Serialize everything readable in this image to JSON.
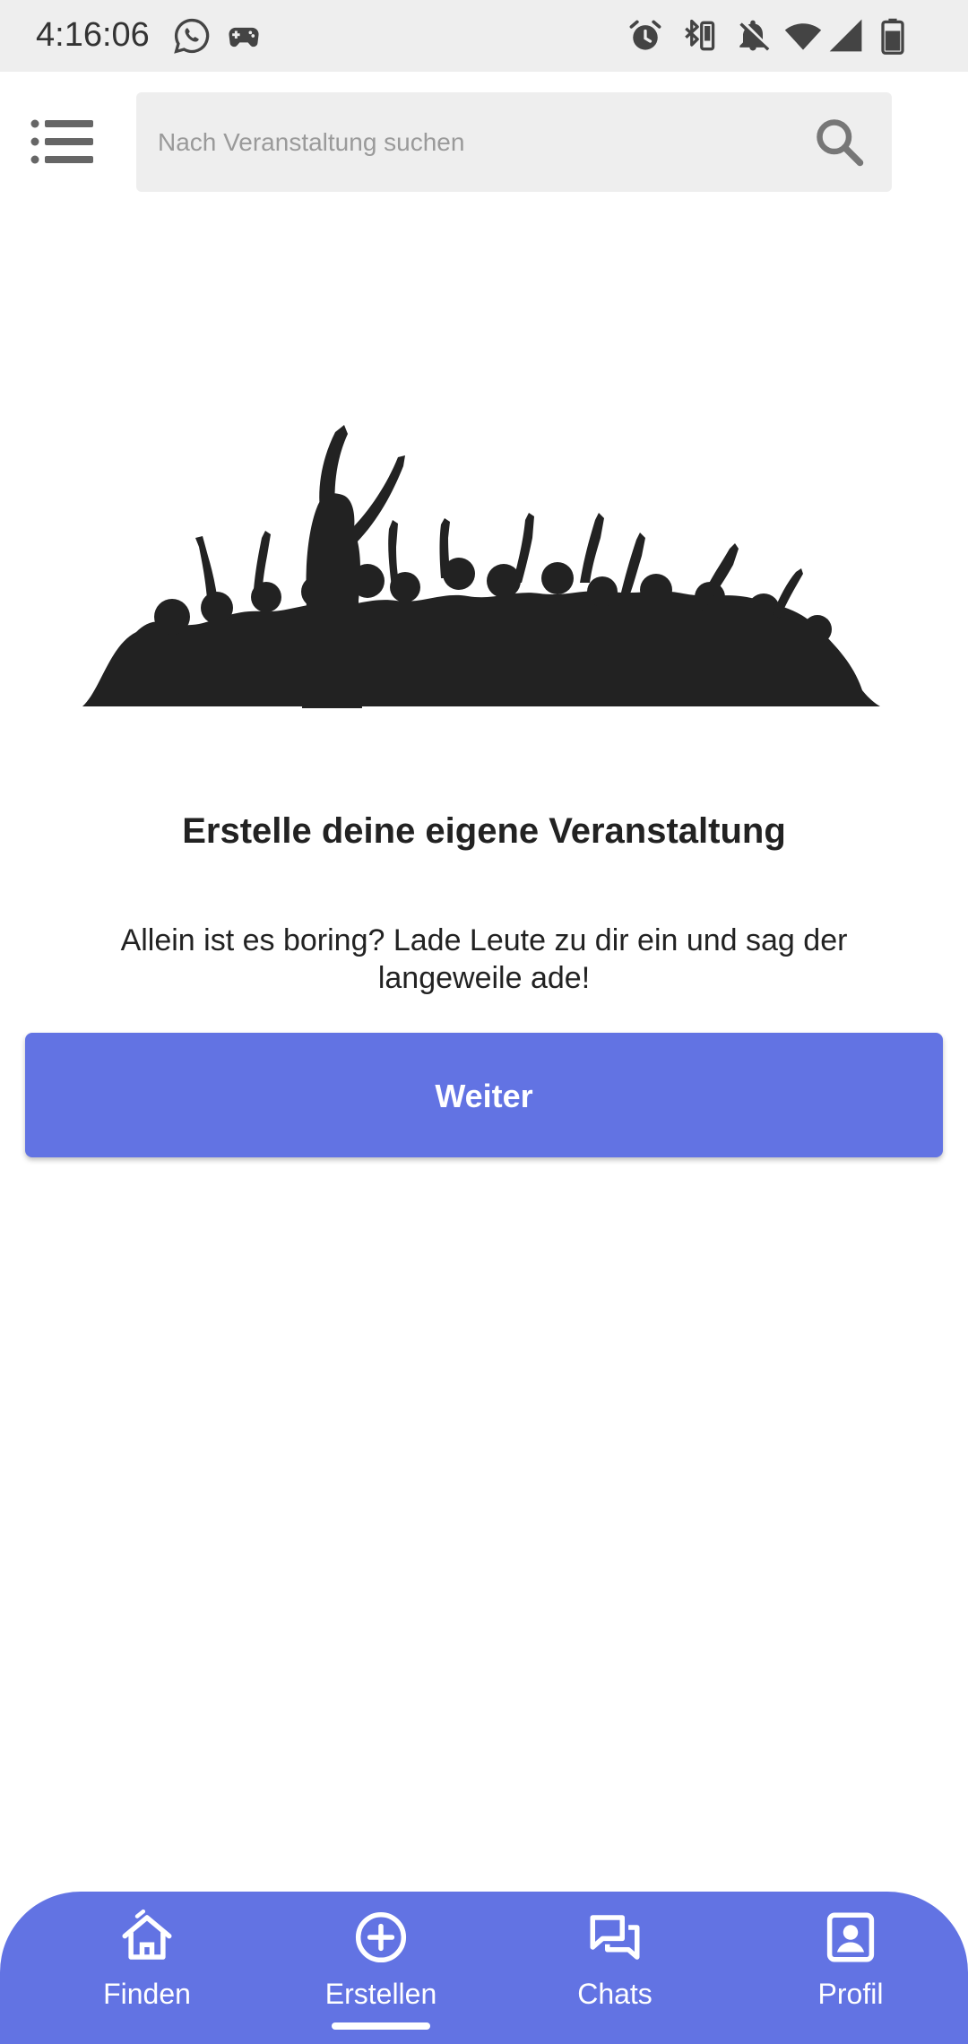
{
  "status_bar": {
    "time": "4:16:06",
    "icons": [
      "whatsapp-icon",
      "game-controller-icon",
      "alarm-icon",
      "bluetooth-vibrate-icon",
      "bell-off-icon",
      "wifi-icon",
      "cell-signal-icon",
      "battery-icon"
    ]
  },
  "header": {
    "menu_icon": "list-menu-icon",
    "search": {
      "placeholder": "Nach Veranstaltung suchen",
      "value": "",
      "icon": "search-icon"
    }
  },
  "main": {
    "illustration": "crowd-silhouette",
    "headline": "Erstelle deine eigene Veranstaltung",
    "description": "Allein ist es boring? Lade Leute zu dir ein und sag der langeweile ade!",
    "button_label": "Weiter"
  },
  "bottom_nav": {
    "items": [
      {
        "label": "Finden",
        "icon": "home-icon",
        "active": false
      },
      {
        "label": "Erstellen",
        "icon": "add-circle-icon",
        "active": true
      },
      {
        "label": "Chats",
        "icon": "chat-bubbles-icon",
        "active": false
      },
      {
        "label": "Profil",
        "icon": "profile-card-icon",
        "active": false
      }
    ]
  },
  "colors": {
    "accent": "#6273e3",
    "status_bar_bg": "#eeeeee",
    "search_bg": "#eeeeee",
    "text_dark": "#222222",
    "illustration": "#222222"
  }
}
